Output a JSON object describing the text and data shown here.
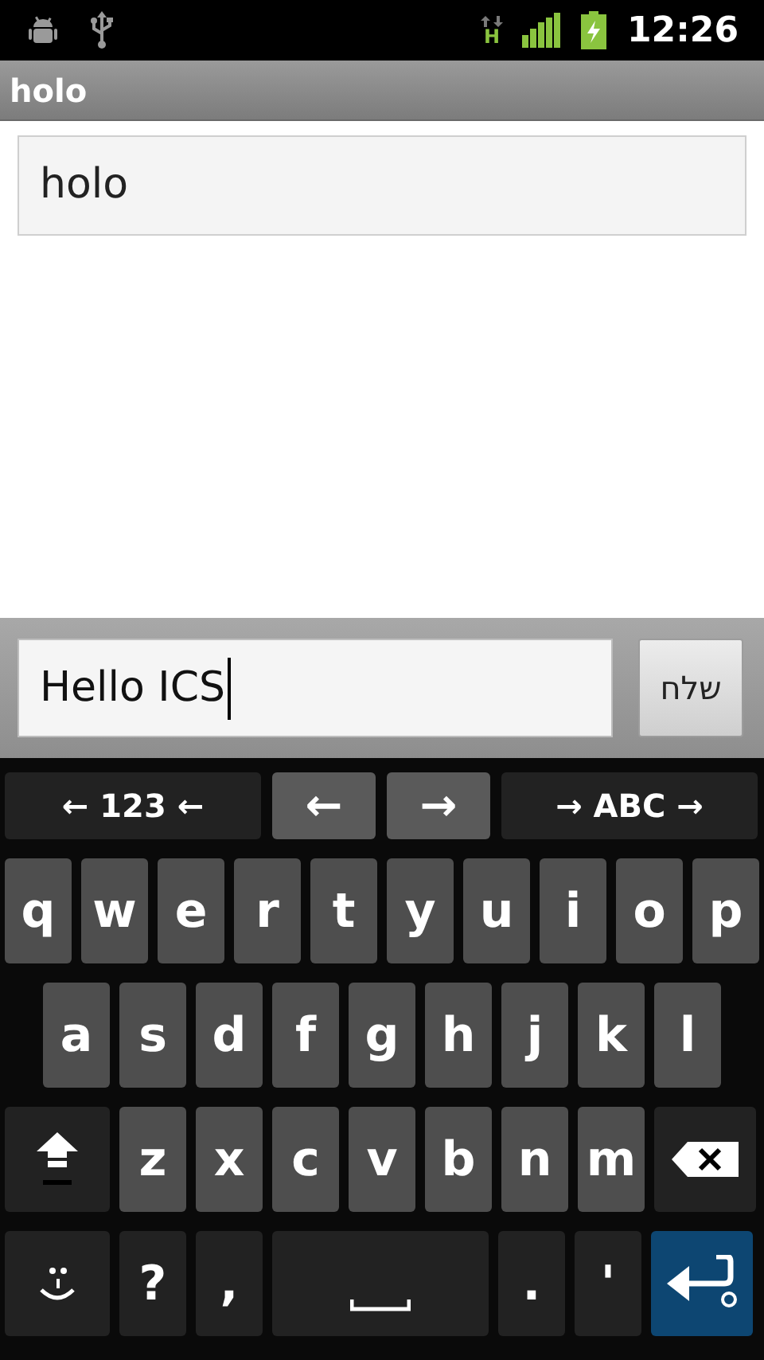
{
  "status_bar": {
    "network_type": "H",
    "time": "12:26"
  },
  "title_bar": {
    "title": "holo"
  },
  "text_field": {
    "value": "holo"
  },
  "compose_bar": {
    "value": "Hello ICS",
    "send_button": "שלח"
  },
  "keyboard": {
    "nav_row": [
      {
        "kind": "mode",
        "label": "← 123 ←"
      },
      {
        "kind": "cursor",
        "label": "←"
      },
      {
        "kind": "cursor",
        "label": "→"
      },
      {
        "kind": "mode",
        "label": "→ ABC →"
      }
    ],
    "rows": [
      {
        "keys": [
          {
            "kind": "letter",
            "label": "q"
          },
          {
            "kind": "letter",
            "label": "w"
          },
          {
            "kind": "letter",
            "label": "e"
          },
          {
            "kind": "letter",
            "label": "r"
          },
          {
            "kind": "letter",
            "label": "t"
          },
          {
            "kind": "letter",
            "label": "y"
          },
          {
            "kind": "letter",
            "label": "u"
          },
          {
            "kind": "letter",
            "label": "i"
          },
          {
            "kind": "letter",
            "label": "o"
          },
          {
            "kind": "letter",
            "label": "p"
          }
        ]
      },
      {
        "keys": [
          {
            "kind": "letter",
            "label": "a"
          },
          {
            "kind": "letter",
            "label": "s"
          },
          {
            "kind": "letter",
            "label": "d"
          },
          {
            "kind": "letter",
            "label": "f"
          },
          {
            "kind": "letter",
            "label": "g"
          },
          {
            "kind": "letter",
            "label": "h"
          },
          {
            "kind": "letter",
            "label": "j"
          },
          {
            "kind": "letter",
            "label": "k"
          },
          {
            "kind": "letter",
            "label": "l"
          }
        ]
      },
      {
        "keys": [
          {
            "kind": "shift"
          },
          {
            "kind": "letter",
            "label": "z"
          },
          {
            "kind": "letter",
            "label": "x"
          },
          {
            "kind": "letter",
            "label": "c"
          },
          {
            "kind": "letter",
            "label": "v"
          },
          {
            "kind": "letter",
            "label": "b"
          },
          {
            "kind": "letter",
            "label": "n"
          },
          {
            "kind": "letter",
            "label": "m"
          },
          {
            "kind": "delete"
          }
        ]
      },
      {
        "keys": [
          {
            "kind": "emoji"
          },
          {
            "kind": "symbol",
            "label": "?"
          },
          {
            "kind": "symbol",
            "label": ","
          },
          {
            "kind": "space"
          },
          {
            "kind": "symbol",
            "label": "."
          },
          {
            "kind": "symbol",
            "label": "'"
          },
          {
            "kind": "enter"
          }
        ]
      }
    ]
  }
}
